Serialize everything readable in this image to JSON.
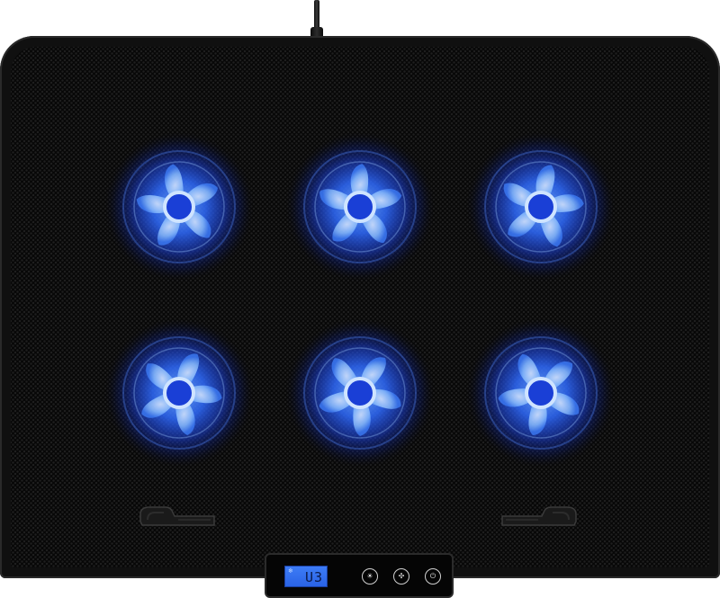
{
  "device": {
    "fan_count": 6,
    "led_color": "#2f6bff",
    "display": {
      "mode_icon": "snowflake-icon",
      "reading": "U3"
    },
    "buttons": [
      {
        "icon": "light-mode-icon"
      },
      {
        "icon": "fan-speed-icon"
      },
      {
        "icon": "power-icon"
      }
    ]
  },
  "colors": {
    "body": "#101010",
    "mesh_hole": "#1e1e1e",
    "lcd": "#3d7cf6",
    "lcd_text": "#0a1a4a"
  }
}
